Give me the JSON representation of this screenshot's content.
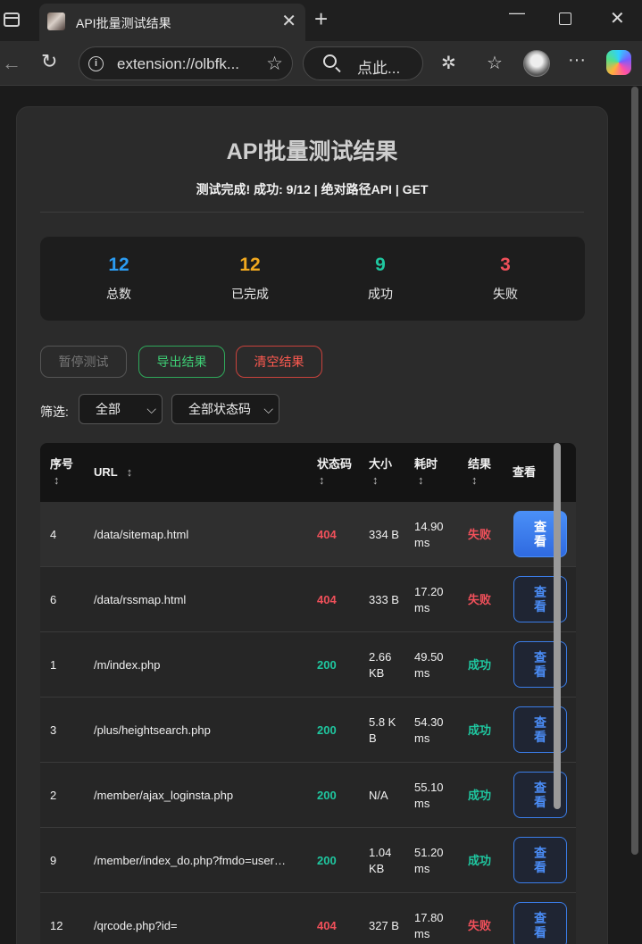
{
  "browser": {
    "tab_title": "API批量测试结果",
    "address": "extension://olbfk...",
    "search_text": "点此..."
  },
  "page": {
    "title": "API批量测试结果",
    "subtitle": "测试完成! 成功: 9/12 | 绝对路径API | GET",
    "stats": [
      {
        "value": "12",
        "label": "总数",
        "color": "#2b9cf2"
      },
      {
        "value": "12",
        "label": "已完成",
        "color": "#f0a81f"
      },
      {
        "value": "9",
        "label": "成功",
        "color": "#1fc7a0"
      },
      {
        "value": "3",
        "label": "失败",
        "color": "#f0505a"
      }
    ],
    "buttons": {
      "pause": "暂停测试",
      "export": "导出结果",
      "clear": "清空结果"
    },
    "filter": {
      "label": "筛选:",
      "select1": "全部",
      "select2": "全部状态码"
    },
    "table": {
      "headers": {
        "index": "序号",
        "url": "URL",
        "status": "状态码",
        "size": "大小",
        "time": "耗时",
        "result": "结果",
        "view": "查看"
      },
      "sort_glyph": "↕",
      "rows": [
        {
          "index": "4",
          "url": "/data/sitemap.html",
          "status": "404",
          "size": "334 B",
          "time": "14.90 ms",
          "result": "失败",
          "view": "查看"
        },
        {
          "index": "6",
          "url": "/data/rssmap.html",
          "status": "404",
          "size": "333 B",
          "time": "17.20 ms",
          "result": "失败",
          "view": "查看"
        },
        {
          "index": "1",
          "url": "/m/index.php",
          "status": "200",
          "size": "2.66 KB",
          "time": "49.50 ms",
          "result": "成功",
          "view": "查看"
        },
        {
          "index": "3",
          "url": "/plus/heightsearch.php",
          "status": "200",
          "size": "5.8 K B",
          "time": "54.30 ms",
          "result": "成功",
          "view": "查看"
        },
        {
          "index": "2",
          "url": "/member/ajax_loginsta.php",
          "status": "200",
          "size": "N/A",
          "time": "55.10 ms",
          "result": "成功",
          "view": "查看"
        },
        {
          "index": "9",
          "url": "/member/index_do.php?fmdo=user…",
          "status": "200",
          "size": "1.04 KB",
          "time": "51.20 ms",
          "result": "成功",
          "view": "查看"
        },
        {
          "index": "12",
          "url": "/qrcode.php?id=",
          "status": "404",
          "size": "327 B",
          "time": "17.80 ms",
          "result": "失败",
          "view": "查看"
        }
      ]
    },
    "colors": {
      "ok": "#1fc7a0",
      "fail": "#f0505a",
      "accent": "#3b7de8"
    }
  }
}
